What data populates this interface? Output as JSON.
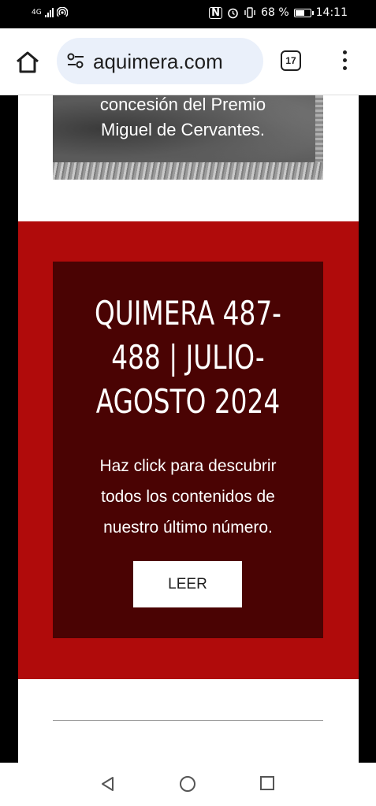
{
  "status_bar": {
    "network": "4G",
    "battery_text": "68 %",
    "battery_level": 0.68,
    "time": "14:11"
  },
  "browser": {
    "url": "aquimera.com",
    "tab_count": "17"
  },
  "hero": {
    "caption": "concesión del Premio\nMiguel de Cervantes."
  },
  "promo": {
    "title": "QUIMERA 487-\n488 | JULIO-\nAGOSTO 2024",
    "description": "Haz click para descubrir\ntodos los contenidos de\nnuestro último número.",
    "button_label": "LEER"
  },
  "colors": {
    "red_section": "#b00b0b",
    "promo_card": "#4a0303",
    "url_pill": "#eaf0fa"
  }
}
